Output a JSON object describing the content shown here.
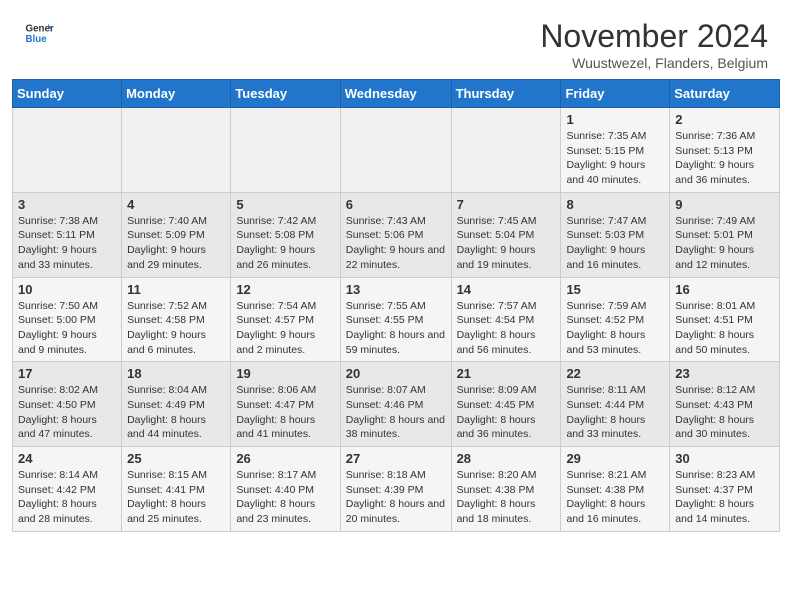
{
  "header": {
    "logo_line1": "General",
    "logo_line2": "Blue",
    "month_title": "November 2024",
    "subtitle": "Wuustwezel, Flanders, Belgium"
  },
  "days_of_week": [
    "Sunday",
    "Monday",
    "Tuesday",
    "Wednesday",
    "Thursday",
    "Friday",
    "Saturday"
  ],
  "weeks": [
    [
      {
        "day": "",
        "info": ""
      },
      {
        "day": "",
        "info": ""
      },
      {
        "day": "",
        "info": ""
      },
      {
        "day": "",
        "info": ""
      },
      {
        "day": "",
        "info": ""
      },
      {
        "day": "1",
        "info": "Sunrise: 7:35 AM\nSunset: 5:15 PM\nDaylight: 9 hours and 40 minutes."
      },
      {
        "day": "2",
        "info": "Sunrise: 7:36 AM\nSunset: 5:13 PM\nDaylight: 9 hours and 36 minutes."
      }
    ],
    [
      {
        "day": "3",
        "info": "Sunrise: 7:38 AM\nSunset: 5:11 PM\nDaylight: 9 hours and 33 minutes."
      },
      {
        "day": "4",
        "info": "Sunrise: 7:40 AM\nSunset: 5:09 PM\nDaylight: 9 hours and 29 minutes."
      },
      {
        "day": "5",
        "info": "Sunrise: 7:42 AM\nSunset: 5:08 PM\nDaylight: 9 hours and 26 minutes."
      },
      {
        "day": "6",
        "info": "Sunrise: 7:43 AM\nSunset: 5:06 PM\nDaylight: 9 hours and 22 minutes."
      },
      {
        "day": "7",
        "info": "Sunrise: 7:45 AM\nSunset: 5:04 PM\nDaylight: 9 hours and 19 minutes."
      },
      {
        "day": "8",
        "info": "Sunrise: 7:47 AM\nSunset: 5:03 PM\nDaylight: 9 hours and 16 minutes."
      },
      {
        "day": "9",
        "info": "Sunrise: 7:49 AM\nSunset: 5:01 PM\nDaylight: 9 hours and 12 minutes."
      }
    ],
    [
      {
        "day": "10",
        "info": "Sunrise: 7:50 AM\nSunset: 5:00 PM\nDaylight: 9 hours and 9 minutes."
      },
      {
        "day": "11",
        "info": "Sunrise: 7:52 AM\nSunset: 4:58 PM\nDaylight: 9 hours and 6 minutes."
      },
      {
        "day": "12",
        "info": "Sunrise: 7:54 AM\nSunset: 4:57 PM\nDaylight: 9 hours and 2 minutes."
      },
      {
        "day": "13",
        "info": "Sunrise: 7:55 AM\nSunset: 4:55 PM\nDaylight: 8 hours and 59 minutes."
      },
      {
        "day": "14",
        "info": "Sunrise: 7:57 AM\nSunset: 4:54 PM\nDaylight: 8 hours and 56 minutes."
      },
      {
        "day": "15",
        "info": "Sunrise: 7:59 AM\nSunset: 4:52 PM\nDaylight: 8 hours and 53 minutes."
      },
      {
        "day": "16",
        "info": "Sunrise: 8:01 AM\nSunset: 4:51 PM\nDaylight: 8 hours and 50 minutes."
      }
    ],
    [
      {
        "day": "17",
        "info": "Sunrise: 8:02 AM\nSunset: 4:50 PM\nDaylight: 8 hours and 47 minutes."
      },
      {
        "day": "18",
        "info": "Sunrise: 8:04 AM\nSunset: 4:49 PM\nDaylight: 8 hours and 44 minutes."
      },
      {
        "day": "19",
        "info": "Sunrise: 8:06 AM\nSunset: 4:47 PM\nDaylight: 8 hours and 41 minutes."
      },
      {
        "day": "20",
        "info": "Sunrise: 8:07 AM\nSunset: 4:46 PM\nDaylight: 8 hours and 38 minutes."
      },
      {
        "day": "21",
        "info": "Sunrise: 8:09 AM\nSunset: 4:45 PM\nDaylight: 8 hours and 36 minutes."
      },
      {
        "day": "22",
        "info": "Sunrise: 8:11 AM\nSunset: 4:44 PM\nDaylight: 8 hours and 33 minutes."
      },
      {
        "day": "23",
        "info": "Sunrise: 8:12 AM\nSunset: 4:43 PM\nDaylight: 8 hours and 30 minutes."
      }
    ],
    [
      {
        "day": "24",
        "info": "Sunrise: 8:14 AM\nSunset: 4:42 PM\nDaylight: 8 hours and 28 minutes."
      },
      {
        "day": "25",
        "info": "Sunrise: 8:15 AM\nSunset: 4:41 PM\nDaylight: 8 hours and 25 minutes."
      },
      {
        "day": "26",
        "info": "Sunrise: 8:17 AM\nSunset: 4:40 PM\nDaylight: 8 hours and 23 minutes."
      },
      {
        "day": "27",
        "info": "Sunrise: 8:18 AM\nSunset: 4:39 PM\nDaylight: 8 hours and 20 minutes."
      },
      {
        "day": "28",
        "info": "Sunrise: 8:20 AM\nSunset: 4:38 PM\nDaylight: 8 hours and 18 minutes."
      },
      {
        "day": "29",
        "info": "Sunrise: 8:21 AM\nSunset: 4:38 PM\nDaylight: 8 hours and 16 minutes."
      },
      {
        "day": "30",
        "info": "Sunrise: 8:23 AM\nSunset: 4:37 PM\nDaylight: 8 hours and 14 minutes."
      }
    ]
  ]
}
